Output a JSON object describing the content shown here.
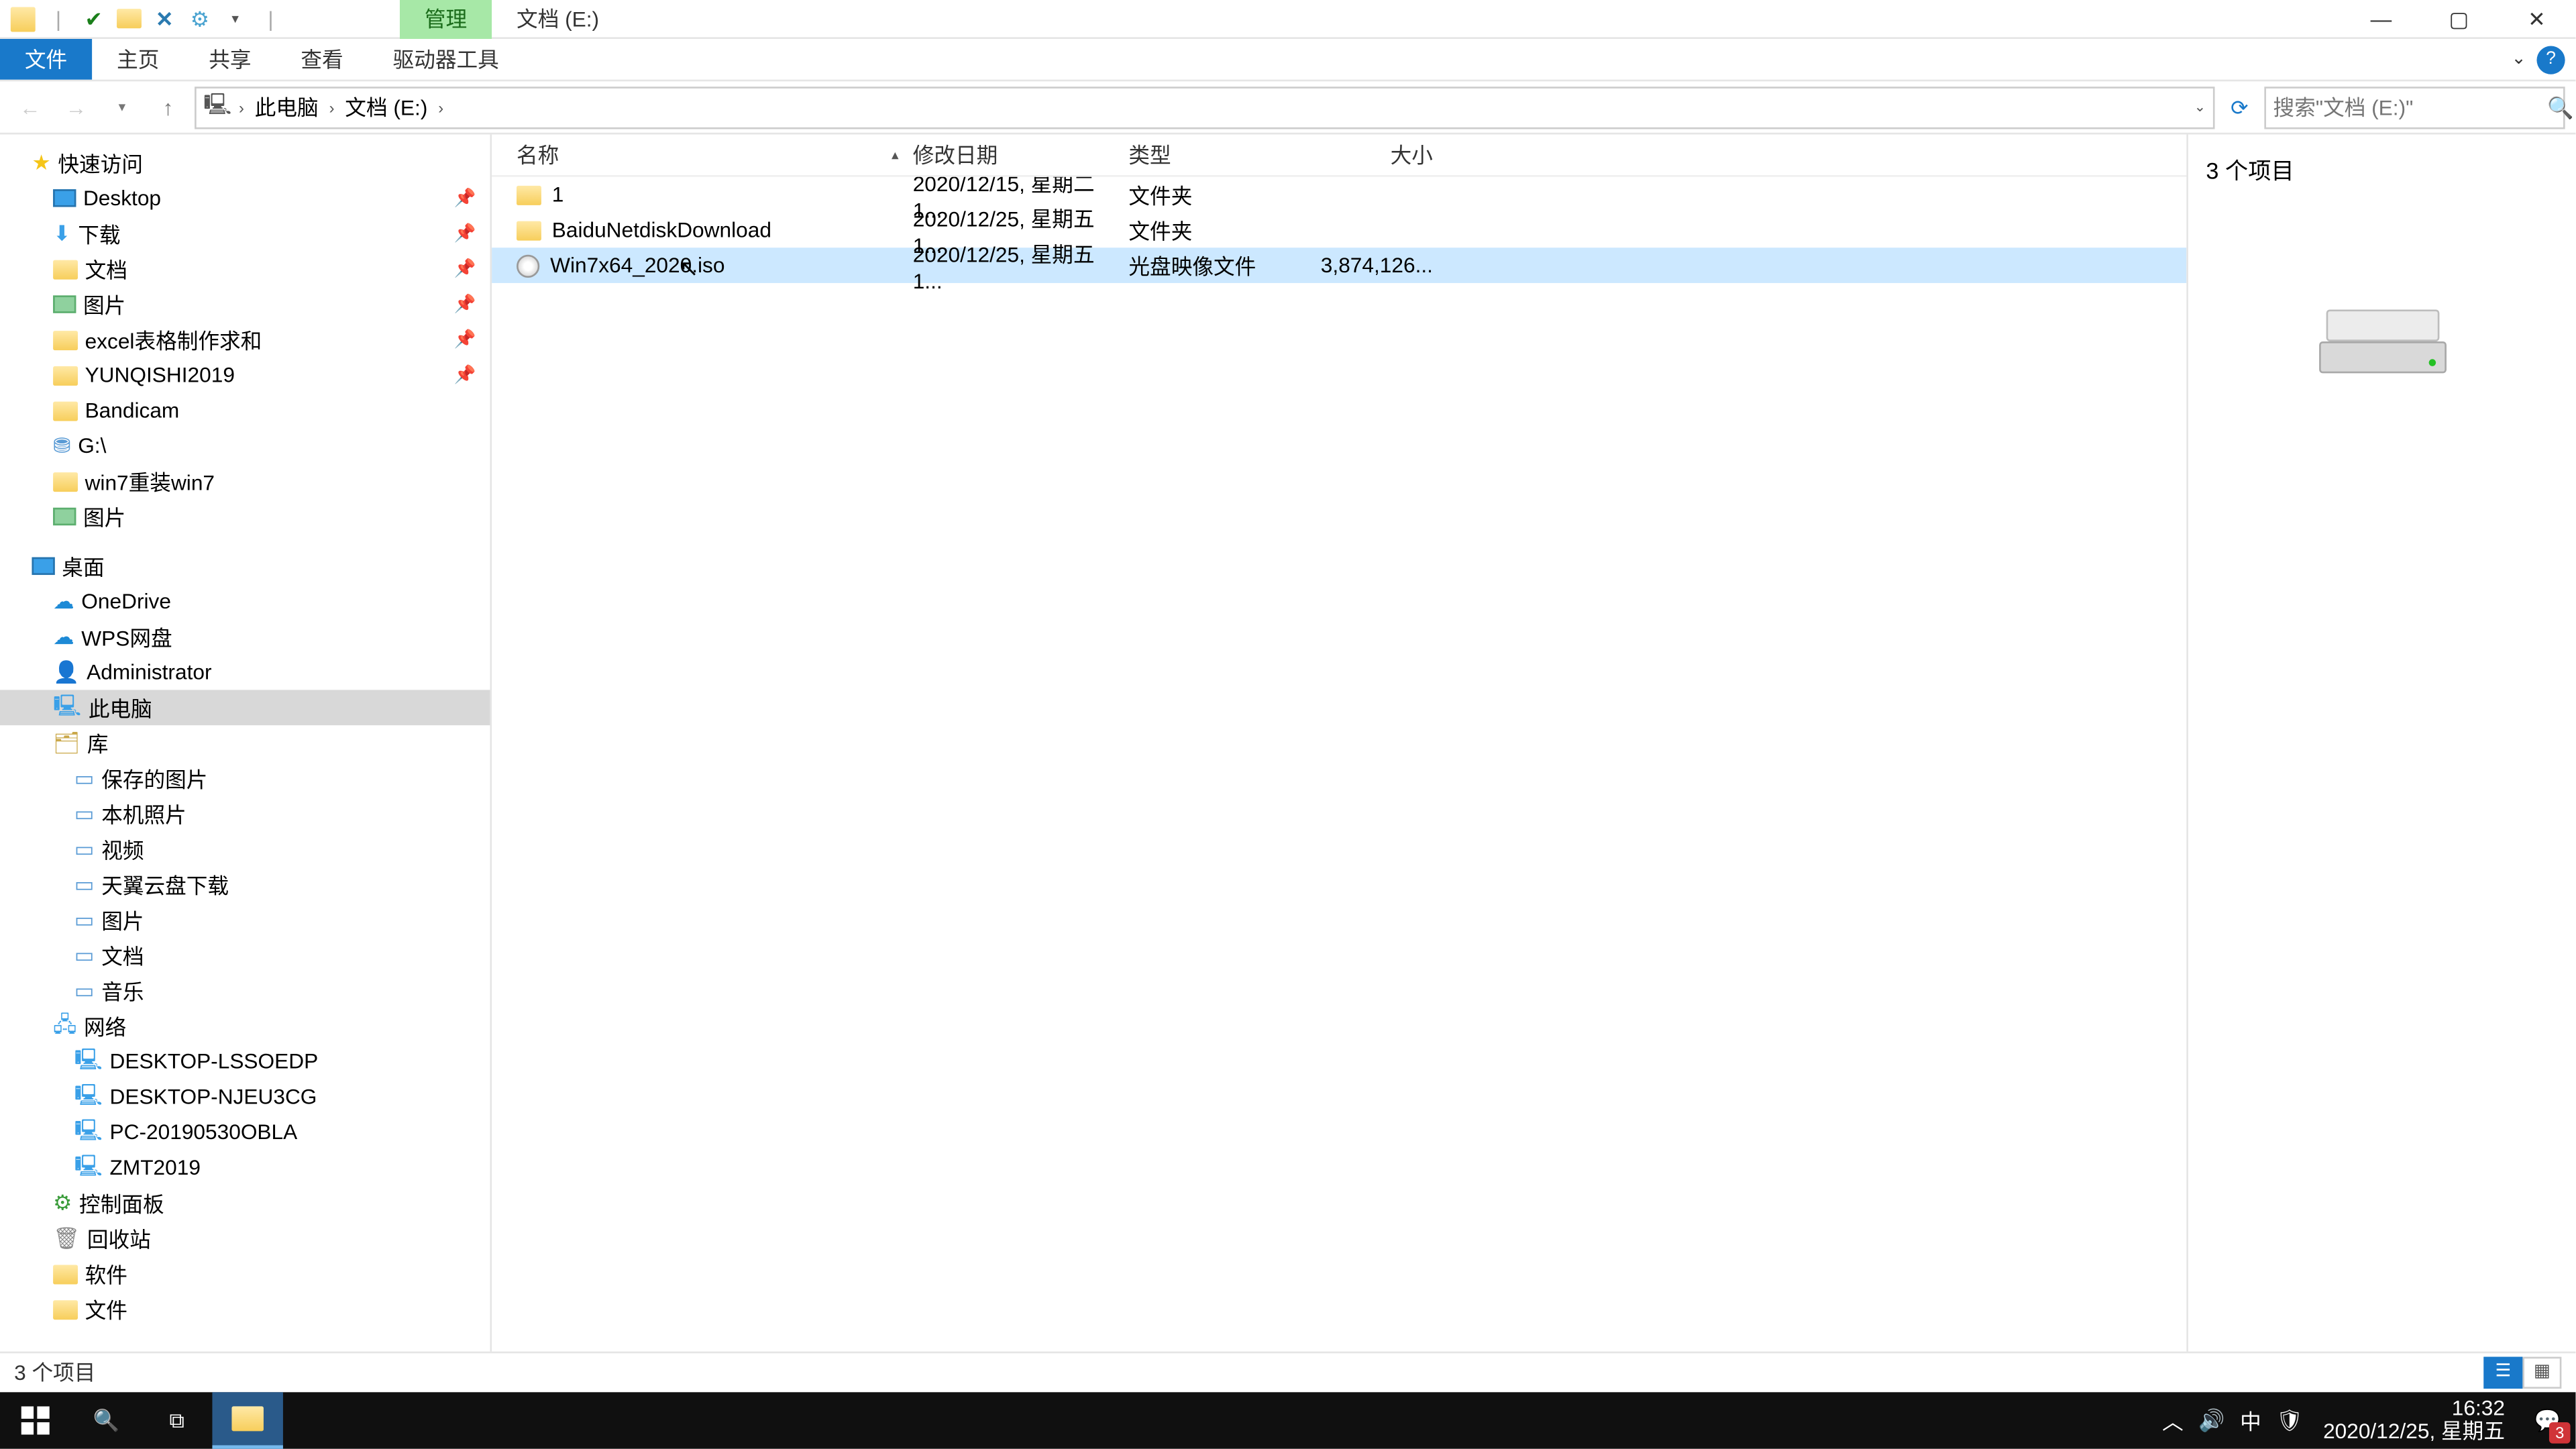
{
  "titlebar": {
    "manage_tab": "管理",
    "location_tab": "文档 (E:)"
  },
  "ribbon": {
    "file": "文件",
    "home": "主页",
    "share": "共享",
    "view": "查看",
    "drive_tools": "驱动器工具"
  },
  "breadcrumb": {
    "this_pc": "此电脑",
    "drive": "文档 (E:)"
  },
  "search": {
    "placeholder": "搜索\"文档 (E:)\""
  },
  "columns": {
    "name": "名称",
    "date": "修改日期",
    "type": "类型",
    "size": "大小"
  },
  "files": [
    {
      "name": "1",
      "date": "2020/12/15, 星期二 1...",
      "type": "文件夹",
      "size": "",
      "kind": "folder"
    },
    {
      "name": "BaiduNetdiskDownload",
      "date": "2020/12/25, 星期五 1...",
      "type": "文件夹",
      "size": "",
      "kind": "folder"
    },
    {
      "name": "Win7x64_2020.iso",
      "date": "2020/12/25, 星期五 1...",
      "type": "光盘映像文件",
      "size": "3,874,126...",
      "kind": "iso",
      "selected": true
    }
  ],
  "nav": {
    "quick_access": "快速访问",
    "qa": [
      {
        "label": "Desktop",
        "icon": "desktop",
        "pin": true
      },
      {
        "label": "下载",
        "icon": "dl",
        "pin": true
      },
      {
        "label": "文档",
        "icon": "folder",
        "pin": true
      },
      {
        "label": "图片",
        "icon": "pic",
        "pin": true
      },
      {
        "label": "excel表格制作求和",
        "icon": "folder",
        "pin": true
      },
      {
        "label": "YUNQISHI2019",
        "icon": "folder",
        "pin": true
      },
      {
        "label": "Bandicam",
        "icon": "folder"
      },
      {
        "label": "G:\\",
        "icon": "drive"
      },
      {
        "label": "win7重装win7",
        "icon": "folder"
      },
      {
        "label": "图片",
        "icon": "pic"
      }
    ],
    "desktop": "桌面",
    "onedrive": "OneDrive",
    "wpspan": "WPS网盘",
    "admin": "Administrator",
    "this_pc": "此电脑",
    "library": "库",
    "lib": [
      {
        "label": "保存的图片"
      },
      {
        "label": "本机照片"
      },
      {
        "label": "视频"
      },
      {
        "label": "天翼云盘下载"
      },
      {
        "label": "图片"
      },
      {
        "label": "文档"
      },
      {
        "label": "音乐"
      }
    ],
    "network": "网络",
    "netitems": [
      {
        "label": "DESKTOP-LSSOEDP"
      },
      {
        "label": "DESKTOP-NJEU3CG"
      },
      {
        "label": "PC-20190530OBLA"
      },
      {
        "label": "ZMT2019"
      }
    ],
    "control_panel": "控制面板",
    "recycle": "回收站",
    "software": "软件",
    "docs": "文件"
  },
  "preview": {
    "title": "3 个项目"
  },
  "status": {
    "text": "3 个项目"
  },
  "taskbar": {
    "time": "16:32",
    "date": "2020/12/25, 星期五",
    "ime": "中",
    "badge": "3"
  }
}
